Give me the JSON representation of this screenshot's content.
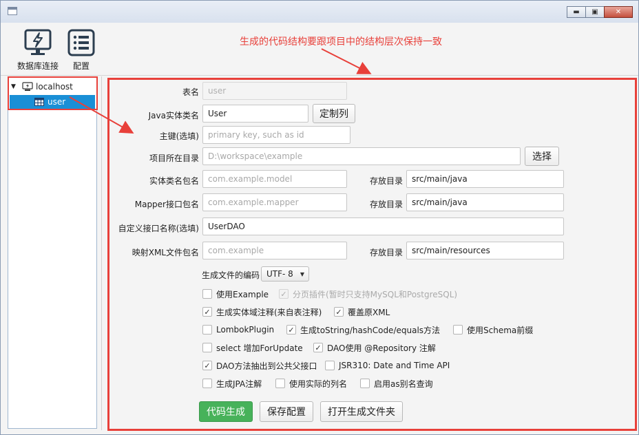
{
  "window": {
    "minimize": "▬",
    "maximize": "▣",
    "close": "✕"
  },
  "toolbar": {
    "db_label": "数据库连接",
    "cfg_label": "配置"
  },
  "annotation": "生成的代码结构要跟项目中的结构层次保持一致",
  "tree": {
    "root_arrow": "▼",
    "root": "localhost",
    "child": "user"
  },
  "form": {
    "table_name_label": "表名",
    "table_name_value": "user",
    "entity_name_label": "Java实体类名",
    "entity_name_value": "User",
    "custom_columns_button": "定制列",
    "pk_label": "主键(选填)",
    "pk_placeholder": "primary key, such as id",
    "project_dir_label": "项目所在目录",
    "project_dir_placeholder": "D:\\workspace\\example",
    "choose_button": "选择",
    "entity_pkg_label": "实体类名包名",
    "entity_pkg_placeholder": "com.example.model",
    "entity_dir_label": "存放目录",
    "entity_dir_value": "src/main/java",
    "mapper_pkg_label": "Mapper接口包名",
    "mapper_pkg_placeholder": "com.example.mapper",
    "mapper_dir_label": "存放目录",
    "mapper_dir_value": "src/main/java",
    "dao_name_label": "自定义接口名称(选填)",
    "dao_name_value": "UserDAO",
    "xml_pkg_label": "映射XML文件包名",
    "xml_pkg_placeholder": "com.example",
    "xml_dir_label": "存放目录",
    "xml_dir_value": "src/main/resources",
    "encoding_label": "生成文件的编码",
    "encoding_value": "UTF- 8",
    "combo_arrow": "▼"
  },
  "options": [
    {
      "label": "使用Example",
      "checked": false,
      "disabled": false
    },
    {
      "label": "分页插件(暂时只支持MySQL和PostgreSQL)",
      "checked": true,
      "disabled": true
    },
    {
      "label": "生成实体域注释(来自表注释)",
      "checked": true,
      "disabled": false
    },
    {
      "label": "覆盖原XML",
      "checked": true,
      "disabled": false
    },
    {
      "label": "LombokPlugin",
      "checked": false,
      "disabled": false
    },
    {
      "label": "生成toString/hashCode/equals方法",
      "checked": true,
      "disabled": false
    },
    {
      "label": "使用Schema前缀",
      "checked": false,
      "disabled": false
    },
    {
      "label": "select 增加ForUpdate",
      "checked": false,
      "disabled": false
    },
    {
      "label": "DAO使用 @Repository 注解",
      "checked": true,
      "disabled": false
    },
    {
      "label": "DAO方法抽出到公共父接口",
      "checked": true,
      "disabled": false
    },
    {
      "label": "JSR310: Date and Time API",
      "checked": false,
      "disabled": false
    },
    {
      "label": "生成JPA注解",
      "checked": false,
      "disabled": false
    },
    {
      "label": "使用实际的列名",
      "checked": false,
      "disabled": false
    },
    {
      "label": "启用as别名查询",
      "checked": false,
      "disabled": false
    }
  ],
  "check_glyph": "✓",
  "actions": {
    "generate": "代码生成",
    "save_config": "保存配置",
    "open_folder": "打开生成文件夹"
  },
  "colors": {
    "annotation_red": "#e8403a",
    "selection_blue": "#1a8fd6",
    "primary_green": "#47b25a"
  }
}
